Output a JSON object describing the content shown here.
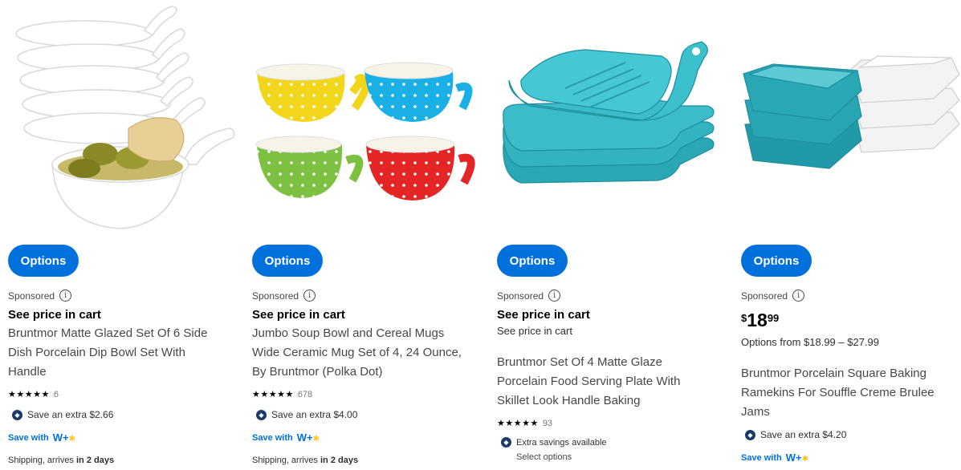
{
  "products": [
    {
      "options_label": "Options",
      "sponsored_label": "Sponsored",
      "price_label": "See price in cart",
      "title_lines": [
        "Bruntmor Matte Glazed Set Of 6 Side",
        "Dish Porcelain Dip Bowl Set With",
        "Handle"
      ],
      "rating_stars": "★★★★★",
      "review_count": "6",
      "save_text": "Save an extra $2.66",
      "save_with_label": "Save with",
      "shipping_prefix": "Shipping, arrives ",
      "shipping_days": "in 2 days"
    },
    {
      "options_label": "Options",
      "sponsored_label": "Sponsored",
      "price_label": "See price in cart",
      "title_lines": [
        "Jumbo Soup Bowl and Cereal Mugs",
        "Wide Ceramic Mug Set of 4, 24 Ounce,",
        "By Bruntmor (Polka Dot)"
      ],
      "rating_stars": "★★★★★",
      "review_count": "678",
      "save_text": "Save an extra $4.00",
      "save_with_label": "Save with",
      "shipping_prefix": "Shipping, arrives ",
      "shipping_days": "in 2 days"
    },
    {
      "options_label": "Options",
      "sponsored_label": "Sponsored",
      "price_label": "See price in cart",
      "sub_price_label": "See price in cart",
      "title_lines": [
        "Bruntmor Set Of 4 Matte Glaze",
        "Porcelain Food Serving Plate With",
        "Skillet Look Handle Baking"
      ],
      "rating_stars": "★★★★★",
      "review_count": "93",
      "extra_savings": "Extra savings available",
      "select_options": "Select options"
    },
    {
      "options_label": "Options",
      "sponsored_label": "Sponsored",
      "price_currency": "$",
      "price_dollars": "18",
      "price_cents": "99",
      "options_range": "Options from $18.99 – $27.99",
      "title_lines": [
        "Bruntmor Porcelain Square Baking",
        "Ramekins For Souffle Creme Brulee",
        "Jams"
      ],
      "save_text": "Save an extra $4.20",
      "save_with_label": "Save with"
    }
  ],
  "wplus_logo": "W+",
  "colors": {
    "brand_blue": "#0071dc",
    "spark_yellow": "#ffc220",
    "teal": "#2aa7b5"
  },
  "icons": [
    "info-icon",
    "tag-savings-icon",
    "walmart-plus-logo",
    "star-icon"
  ]
}
